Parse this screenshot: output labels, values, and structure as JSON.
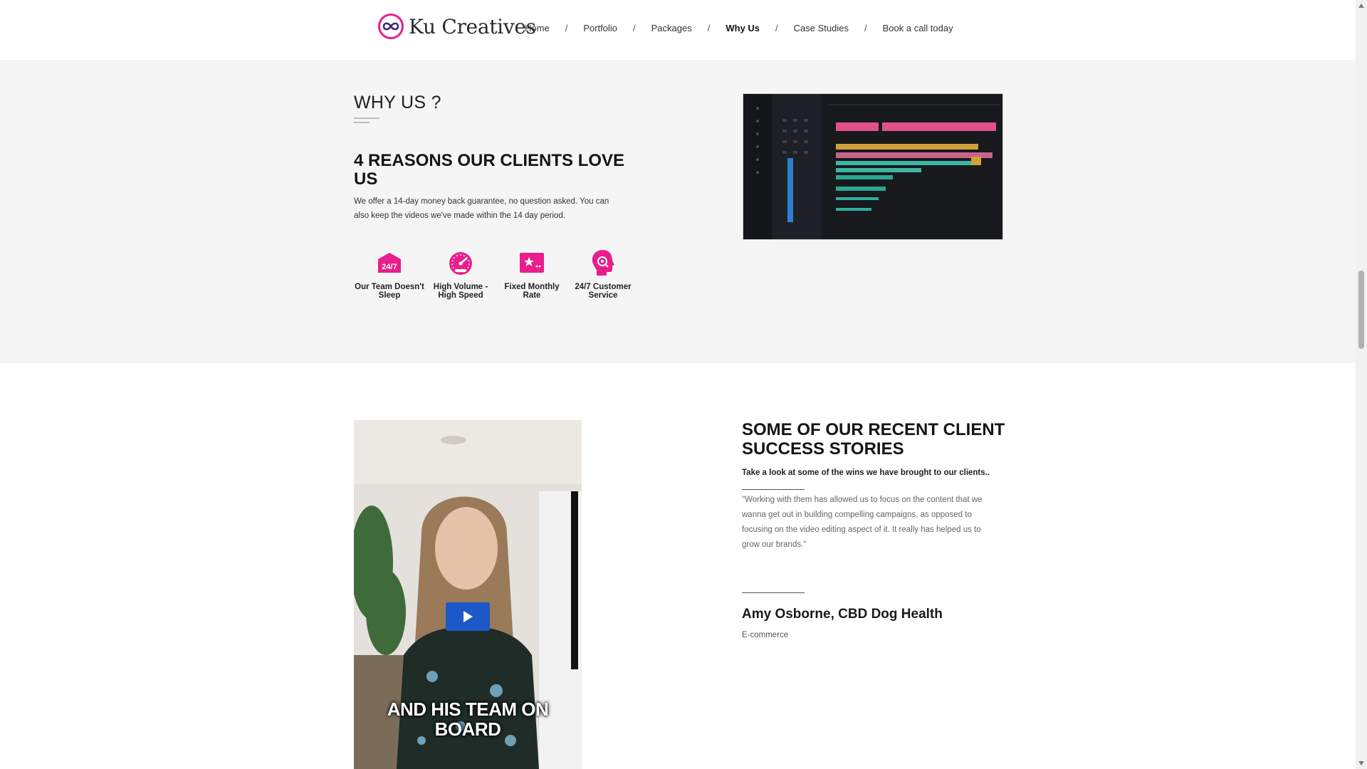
{
  "header": {
    "logo_text": "Ku Creatives",
    "nav": [
      {
        "label": "Home"
      },
      {
        "label": "Portfolio"
      },
      {
        "label": "Packages"
      },
      {
        "label": "Why Us"
      },
      {
        "label": "Case Studies"
      },
      {
        "label": "Book a call today"
      }
    ],
    "separator": "/",
    "active_nav": "Why Us",
    "accent_color": "#e91e8c"
  },
  "why": {
    "title": "WHY US ?",
    "reasons_title": "4 REASONS OUR CLIENTS LOVE US",
    "description": "We offer a 14-day money back guarantee, no question asked. You can also keep the videos we've made within the 14 day period.",
    "features": [
      {
        "icon": "clock-24-7-icon",
        "label": "Our Team Doesn't Sleep"
      },
      {
        "icon": "speedometer-icon",
        "label": "High Volume - High Speed"
      },
      {
        "icon": "rate-card-icon",
        "label": "Fixed Monthly Rate"
      },
      {
        "icon": "support-headset-icon",
        "label": "24/7 Customer Service"
      }
    ],
    "badge_text": "24/7"
  },
  "stories": {
    "title": "SOME OF OUR RECENT CLIENT SUCCESS STORIES",
    "subtitle": "Take a look at some of the wins we have brought to our clients..",
    "quote": "\"Working with them has allowed us to focus on the content that we wanna get out in building compelling campaigns, as opposed to focusing on the video editing aspect of it. It really has helped us to grow our brands.\"",
    "author": "Amy Osborne, CBD Dog Health",
    "author_tag": "E-commerce",
    "video_caption": "AND HIS TEAM ON BOARD"
  }
}
